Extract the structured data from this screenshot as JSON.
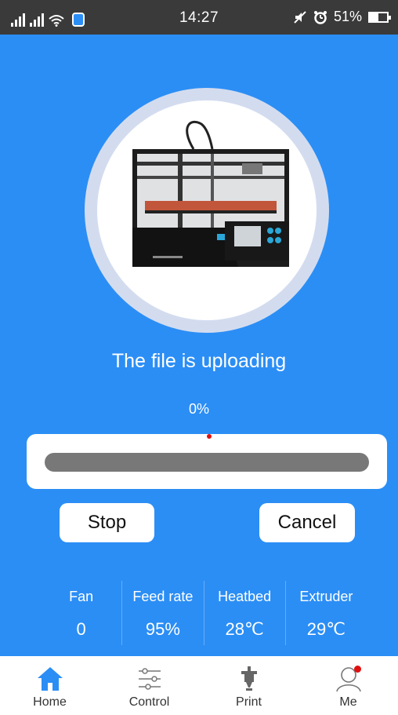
{
  "status_bar": {
    "network_label": "ıll",
    "time": "14:27",
    "battery": "51%",
    "battery_level": 0.51,
    "icons": [
      "signal-icon",
      "wifi-icon",
      "shield-app-icon",
      "mute-icon",
      "alarm-icon",
      "battery-icon"
    ]
  },
  "upload": {
    "title": "The file is uploading",
    "percent": "0%",
    "progress": 0.0
  },
  "buttons": {
    "stop": "Stop",
    "cancel": "Cancel"
  },
  "stats": [
    {
      "label": "Fan",
      "value": "0"
    },
    {
      "label": "Feed rate",
      "value": "95%"
    },
    {
      "label": "Heatbed",
      "value": "28℃"
    },
    {
      "label": "Extruder",
      "value": "29℃"
    }
  ],
  "tabs": [
    {
      "label": "Home",
      "icon": "home-icon",
      "active": true
    },
    {
      "label": "Control",
      "icon": "sliders-icon",
      "active": false
    },
    {
      "label": "Print",
      "icon": "print-nozzle-icon",
      "active": false
    },
    {
      "label": "Me",
      "icon": "user-icon",
      "active": false,
      "badge": true
    }
  ],
  "colors": {
    "background": "#2b8ef5",
    "status_bar": "#3a3a3a",
    "track": "#787878",
    "accent_red": "#e01010",
    "active_tab_icon": "#2b8ef5"
  }
}
